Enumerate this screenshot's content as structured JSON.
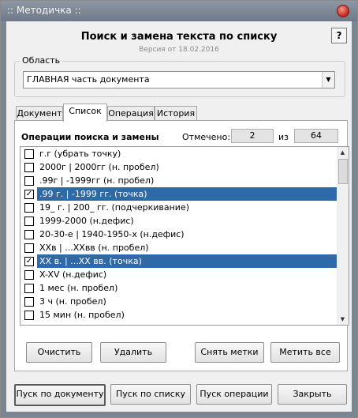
{
  "window": {
    "title": ":: Методичка ::"
  },
  "header": {
    "title": "Поиск и замена текста по списку",
    "version": "Версия от 18.02.2016",
    "help_label": "?"
  },
  "area": {
    "label": "Область",
    "selected": "ГЛАВНАЯ часть документа",
    "arrow": "▼"
  },
  "tabs": [
    {
      "label": "Документ"
    },
    {
      "label": "Список",
      "active": true
    },
    {
      "label": "Операция"
    },
    {
      "label": "История"
    }
  ],
  "panel": {
    "title": "Операции поиска и замены",
    "marked_label": "Отмечено:",
    "marked_value": "2",
    "of_label": "из",
    "total_value": "64"
  },
  "scrollbar": {
    "up": "▲",
    "down": "▼"
  },
  "list_items": [
    {
      "text": "г.г (убрать точку)",
      "checked": false,
      "selected": false
    },
    {
      "text": "2000г | 2000гг (н. пробел)",
      "checked": false,
      "selected": false
    },
    {
      "text": ".99г | -1999гг (н. пробел)",
      "checked": false,
      "selected": false
    },
    {
      "text": ".99 г. | -1999 гг. (точка)",
      "checked": true,
      "selected": true
    },
    {
      "text": "19_ г. | 200_ гг. (подчеркивание)",
      "checked": false,
      "selected": false
    },
    {
      "text": "1999-2000 (н.дефис)",
      "checked": false,
      "selected": false
    },
    {
      "text": "20-30-е | 1940-1950-х (н.дефис)",
      "checked": false,
      "selected": false
    },
    {
      "text": "XXв | ...XXвв (н. пробел)",
      "checked": false,
      "selected": false
    },
    {
      "text": "XX в. | ...XX вв. (точка)",
      "checked": true,
      "selected": true
    },
    {
      "text": "X-XV (н.дефис)",
      "checked": false,
      "selected": false
    },
    {
      "text": "1 мес (н. пробел)",
      "checked": false,
      "selected": false
    },
    {
      "text": "3 ч (н. пробел)",
      "checked": false,
      "selected": false
    },
    {
      "text": "15 мин (н. пробел)",
      "checked": false,
      "selected": false
    }
  ],
  "list_buttons": {
    "clear": "Очистить",
    "delete": "Удалить",
    "unmark": "Снять метки",
    "mark_all": "Метить все"
  },
  "bottom_buttons": {
    "run_document": "Пуск по документу",
    "run_list": "Пуск по списку",
    "run_operation": "Пуск операции",
    "close": "Закрыть"
  }
}
